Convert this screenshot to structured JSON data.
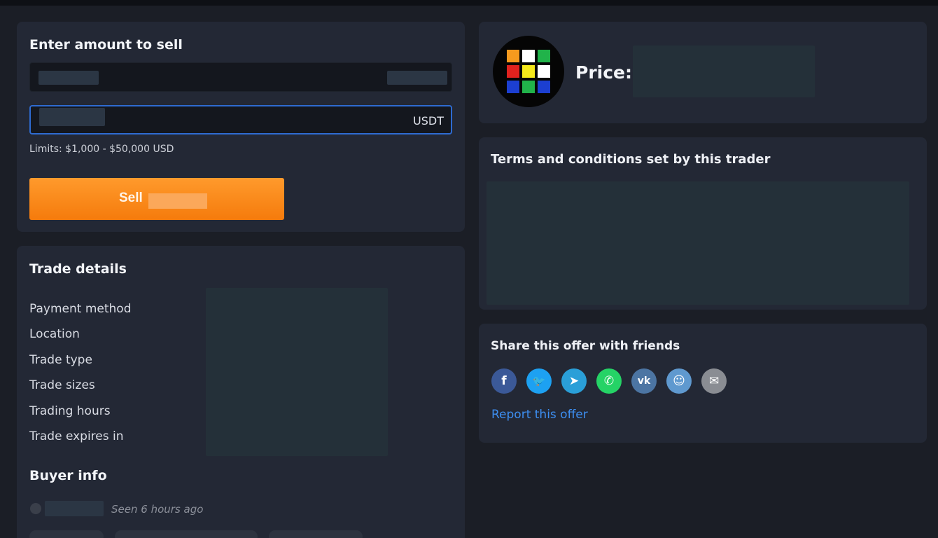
{
  "sell": {
    "title": "Enter amount to sell",
    "amount_suffix": "USDT",
    "limits": "Limits: $1,000 - $50,000 USD",
    "sell_label": "Sell"
  },
  "price": {
    "label": "Price:",
    "logo_colors": [
      [
        "#f59a1e",
        "#ffffff",
        "#21b34a"
      ],
      [
        "#e0221e",
        "#f5e91b",
        "#ffffff"
      ],
      [
        "#1c3fd1",
        "#21b34a",
        "#1c3fd1"
      ]
    ]
  },
  "terms": {
    "title": "Terms and conditions set by this trader"
  },
  "share": {
    "title": "Share this offer with friends",
    "icons": [
      {
        "name": "facebook-icon",
        "glyph": "f",
        "color": "#3b5998"
      },
      {
        "name": "twitter-icon",
        "glyph": "🐦",
        "color": "#1da1f2"
      },
      {
        "name": "telegram-icon",
        "glyph": "➤",
        "color": "#2a9fd8"
      },
      {
        "name": "whatsapp-icon",
        "glyph": "✆",
        "color": "#25d366"
      },
      {
        "name": "vk-icon",
        "glyph": "vk",
        "color": "#4c75a3"
      },
      {
        "name": "reddit-icon",
        "glyph": "☺",
        "color": "#5f99cf"
      },
      {
        "name": "email-icon",
        "glyph": "✉",
        "color": "#8a8d93"
      }
    ],
    "report_label": "Report this offer"
  },
  "trade_details": {
    "title": "Trade details",
    "rows": [
      "Payment method",
      "Location",
      "Trade type",
      "Trade sizes",
      "Trading hours",
      "Trade expires in"
    ]
  },
  "buyer": {
    "title": "Buyer info",
    "seen": "Seen 6 hours ago"
  }
}
